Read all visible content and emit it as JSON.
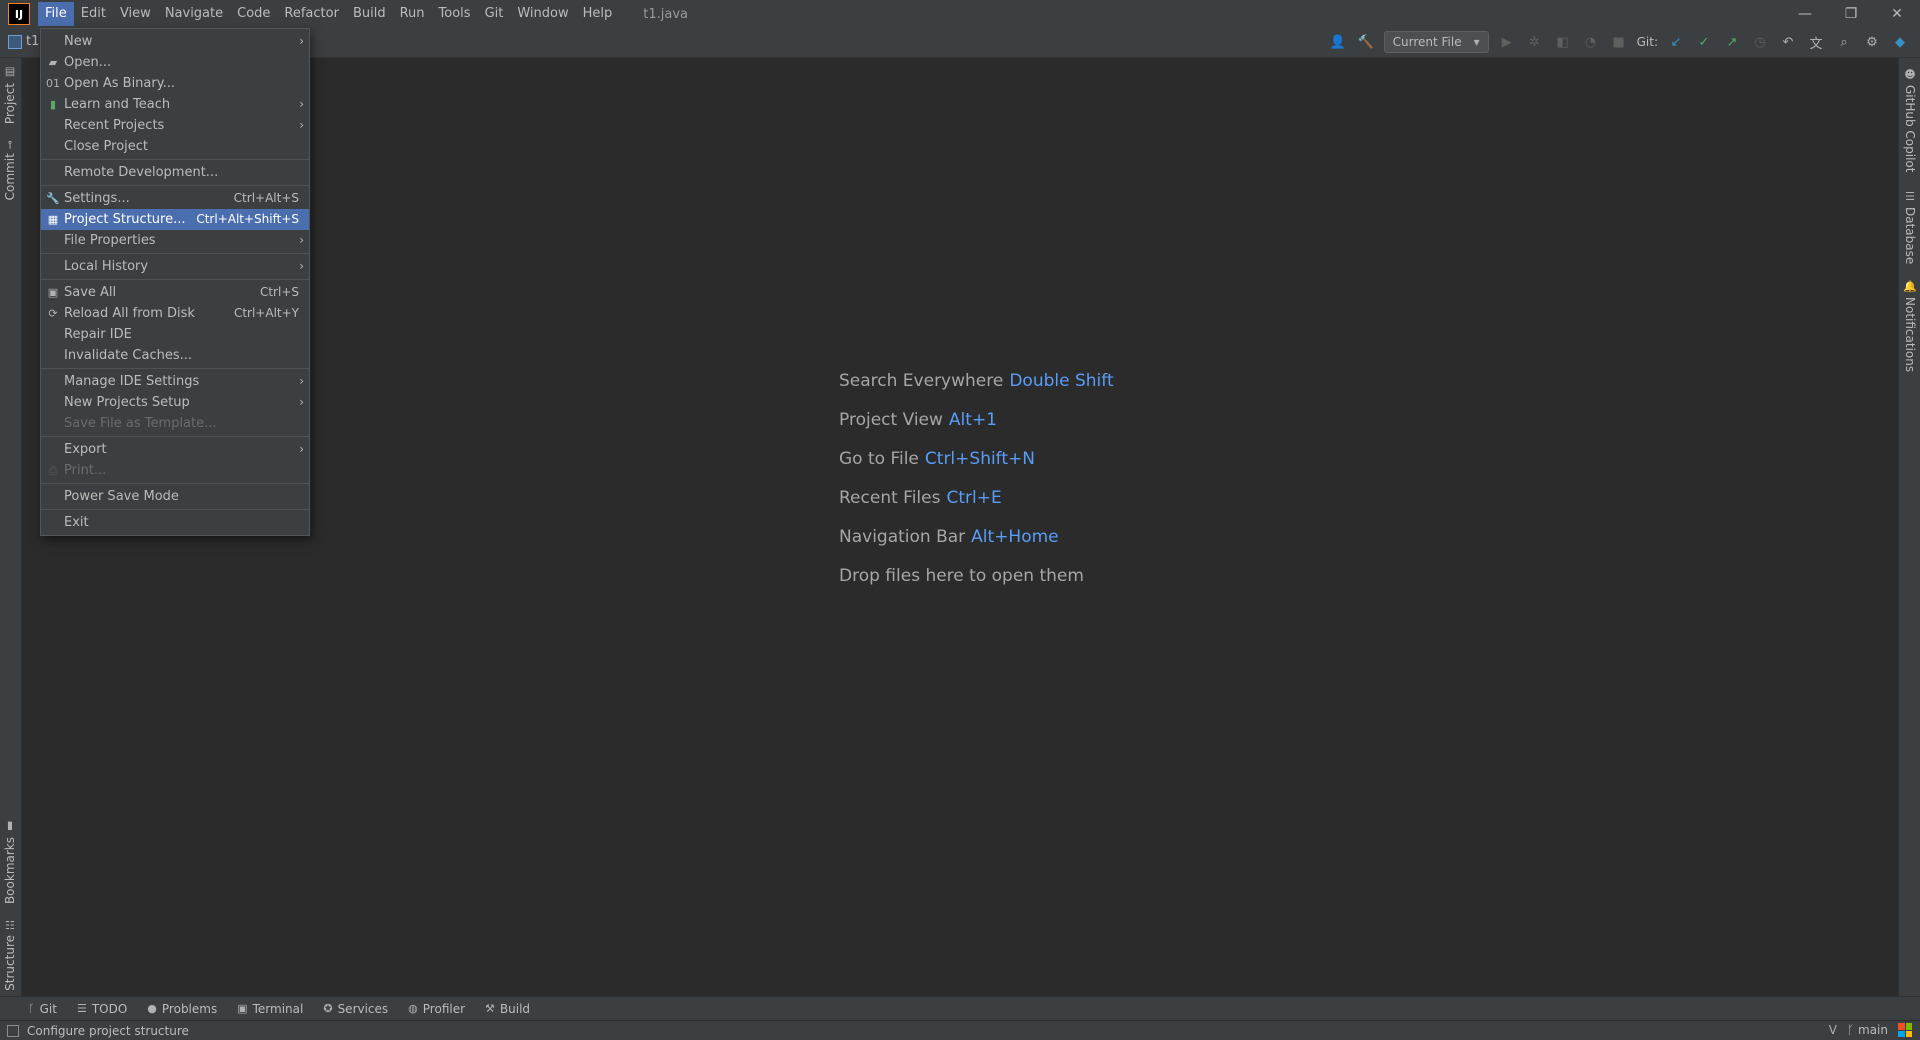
{
  "window": {
    "file_title": "t1.java",
    "app_logo": "IJ",
    "controls": [
      "—",
      "❐",
      "✕"
    ]
  },
  "main_menu": [
    {
      "label": "File",
      "active": true
    },
    {
      "label": "Edit"
    },
    {
      "label": "View"
    },
    {
      "label": "Navigate"
    },
    {
      "label": "Code"
    },
    {
      "label": "Refactor"
    },
    {
      "label": "Build"
    },
    {
      "label": "Run"
    },
    {
      "label": "Tools"
    },
    {
      "label": "Git"
    },
    {
      "label": "Window"
    },
    {
      "label": "Help"
    }
  ],
  "toolbar": {
    "project_crumb": "t1",
    "run_config": "Current File",
    "git_label": "Git:"
  },
  "file_menu": {
    "items": [
      {
        "label": "New",
        "submenu": true
      },
      {
        "label": "Open...",
        "icon": "folder-icon"
      },
      {
        "label": "Open As Binary...",
        "icon": "binary-icon"
      },
      {
        "label": "Learn and Teach",
        "icon": "book-icon",
        "submenu": true
      },
      {
        "label": "Recent Projects",
        "submenu": true
      },
      {
        "label": "Close Project"
      },
      {
        "separator": true
      },
      {
        "label": "Remote Development..."
      },
      {
        "separator": true
      },
      {
        "label": "Settings...",
        "icon": "wrench-icon",
        "shortcut": "Ctrl+Alt+S"
      },
      {
        "label": "Project Structure...",
        "icon": "project-structure-icon",
        "shortcut": "Ctrl+Alt+Shift+S",
        "selected": true
      },
      {
        "label": "File Properties",
        "submenu": true
      },
      {
        "separator": true
      },
      {
        "label": "Local History",
        "submenu": true
      },
      {
        "separator": true
      },
      {
        "label": "Save All",
        "icon": "save-icon",
        "shortcut": "Ctrl+S"
      },
      {
        "label": "Reload All from Disk",
        "icon": "reload-icon",
        "shortcut": "Ctrl+Alt+Y"
      },
      {
        "label": "Repair IDE"
      },
      {
        "label": "Invalidate Caches..."
      },
      {
        "separator": true
      },
      {
        "label": "Manage IDE Settings",
        "submenu": true
      },
      {
        "label": "New Projects Setup",
        "submenu": true
      },
      {
        "label": "Save File as Template...",
        "disabled": true
      },
      {
        "separator": true
      },
      {
        "label": "Export",
        "submenu": true
      },
      {
        "label": "Print...",
        "icon": "print-icon",
        "disabled": true
      },
      {
        "separator": true
      },
      {
        "label": "Power Save Mode"
      },
      {
        "separator": true
      },
      {
        "label": "Exit"
      }
    ]
  },
  "left_stripe": {
    "project": "Project",
    "commit": "Commit",
    "bookmarks": "Bookmarks",
    "structure": "Structure"
  },
  "right_stripe": {
    "copilot": "GitHub Copilot",
    "database": "Database",
    "notifications": "Notifications"
  },
  "editor_hints": [
    {
      "label": "Search Everywhere",
      "key": "Double Shift"
    },
    {
      "label": "Project View",
      "key": "Alt+1"
    },
    {
      "label": "Go to File",
      "key": "Ctrl+Shift+N"
    },
    {
      "label": "Recent Files",
      "key": "Ctrl+E"
    },
    {
      "label": "Navigation Bar",
      "key": "Alt+Home"
    },
    {
      "label": "Drop files here to open them",
      "key": ""
    }
  ],
  "bottom_tools": [
    {
      "label": "Git",
      "icon": "branch-icon"
    },
    {
      "label": "TODO",
      "icon": "list-icon"
    },
    {
      "label": "Problems",
      "icon": "problems-icon"
    },
    {
      "label": "Terminal",
      "icon": "terminal-icon"
    },
    {
      "label": "Services",
      "icon": "services-icon"
    },
    {
      "label": "Profiler",
      "icon": "profiler-icon"
    },
    {
      "label": "Build",
      "icon": "hammer-icon"
    }
  ],
  "status": {
    "message": "Configure project structure",
    "branch": "main"
  },
  "colors": {
    "accent": "#4b6eaf",
    "shortcut_blue": "#589df6",
    "background": "#2b2b2b",
    "panel": "#3c3f41"
  }
}
